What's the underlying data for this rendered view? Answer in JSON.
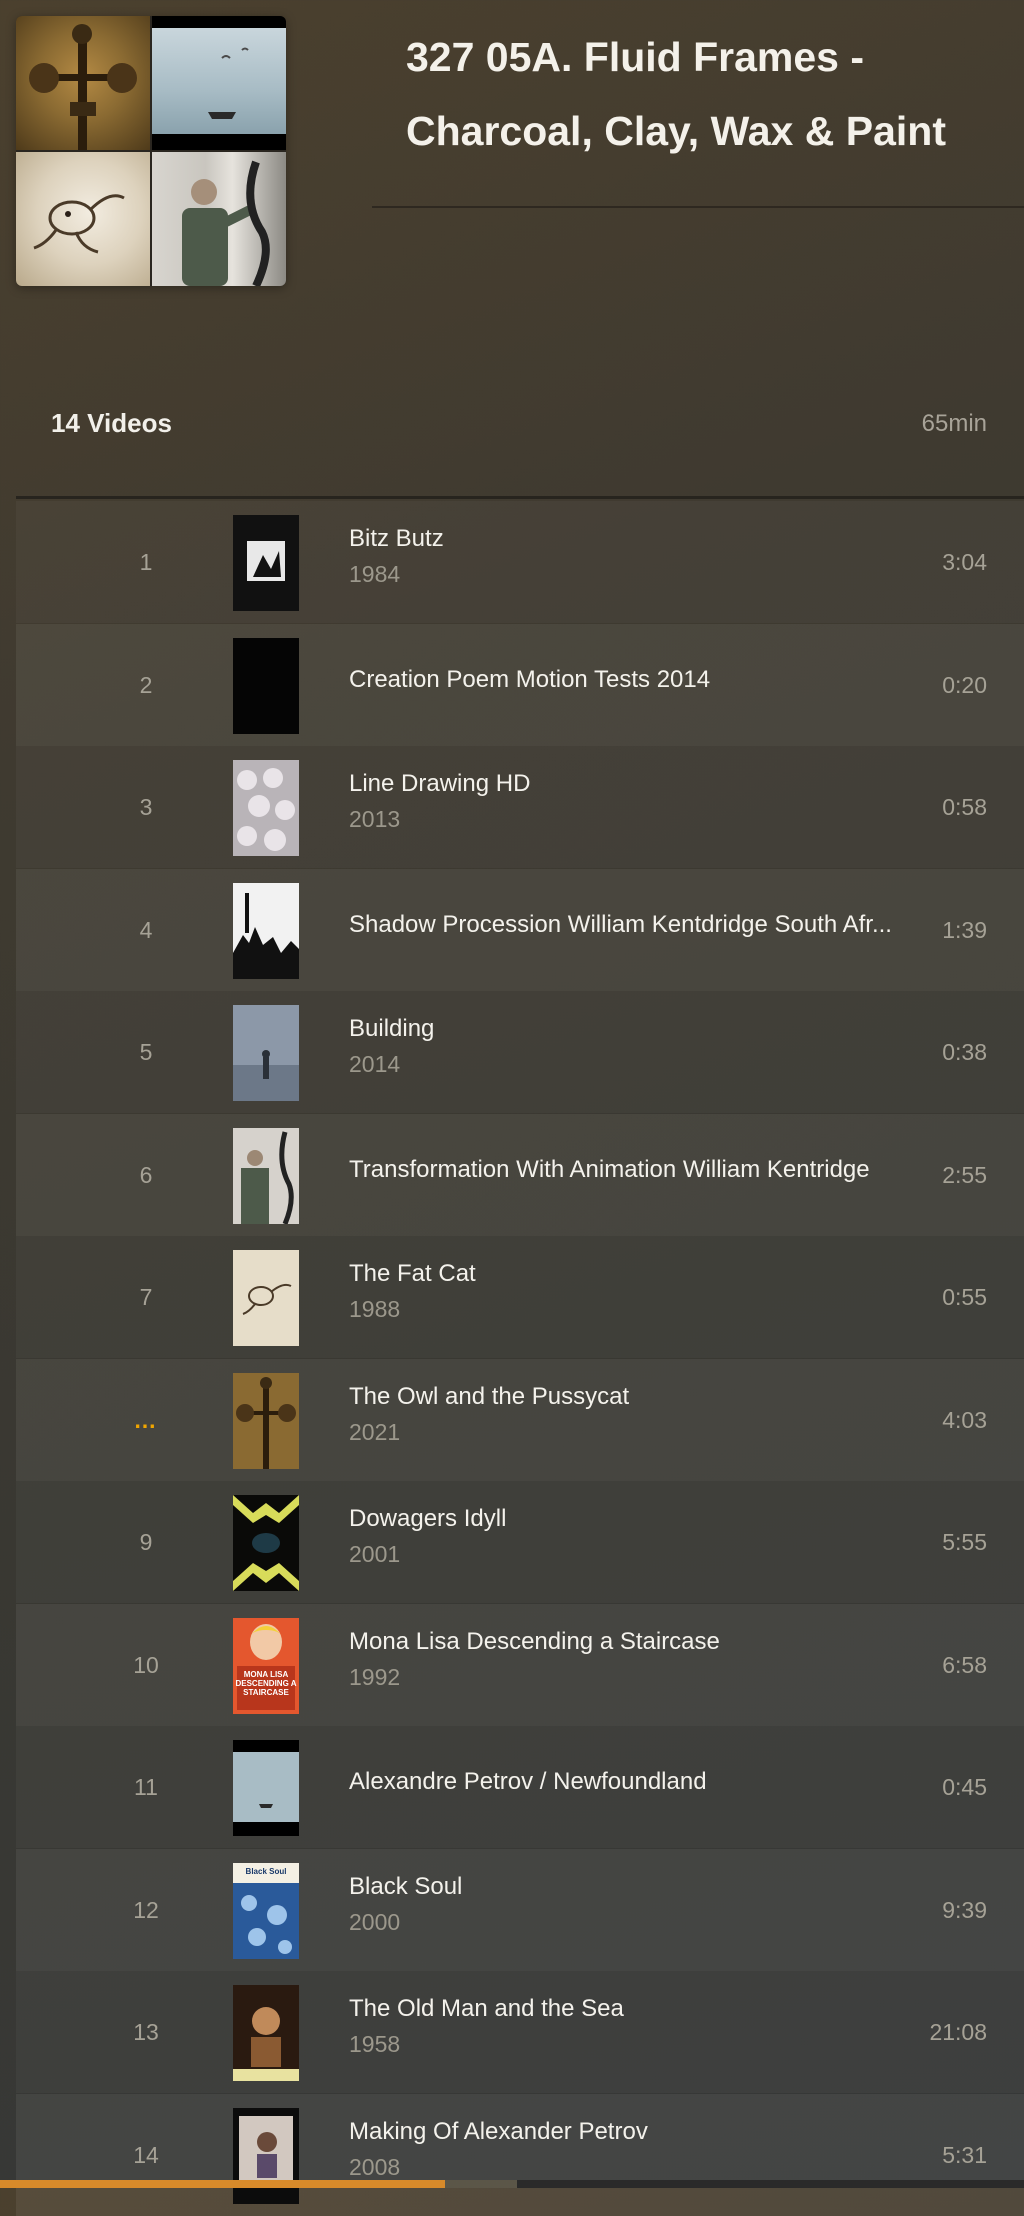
{
  "header": {
    "title": "327 05A. Fluid Frames - Charcoal, Clay, Wax & Paint"
  },
  "summary": {
    "count": "14 Videos",
    "total": "65min"
  },
  "videos": [
    {
      "number": "1",
      "title": "Bitz Butz",
      "year": "1984",
      "duration": "3:04",
      "thumb_icon": "bitz-butz-poster"
    },
    {
      "number": "2",
      "title": "Creation Poem Motion Tests 2014",
      "year": "",
      "duration": "0:20",
      "thumb_icon": "black-frame"
    },
    {
      "number": "3",
      "title": "Line Drawing HD",
      "year": "2013",
      "duration": "0:58",
      "thumb_icon": "pattern-frame"
    },
    {
      "number": "4",
      "title": "Shadow Procession William Kentdridge South Afr...",
      "year": "",
      "duration": "1:39",
      "thumb_icon": "silhouette-frame"
    },
    {
      "number": "5",
      "title": "Building",
      "year": "2014",
      "duration": "0:38",
      "thumb_icon": "foggy-figure-frame"
    },
    {
      "number": "6",
      "title": "Transformation With Animation William Kentridge",
      "year": "",
      "duration": "2:55",
      "thumb_icon": "artist-drawing-frame"
    },
    {
      "number": "7",
      "title": "The Fat Cat",
      "year": "1988",
      "duration": "0:55",
      "thumb_icon": "cat-sketch-frame"
    },
    {
      "number": "…",
      "title": "The Owl and the Pussycat",
      "year": "2021",
      "duration": "4:03",
      "thumb_icon": "owl-frame",
      "playing": true
    },
    {
      "number": "9",
      "title": "Dowagers Idyll",
      "year": "2001",
      "duration": "5:55",
      "thumb_icon": "kaleidoscope-frame"
    },
    {
      "number": "10",
      "title": "Mona Lisa Descending a Staircase",
      "year": "1992",
      "duration": "6:58",
      "thumb_icon": "mona-lisa-poster",
      "thumb_text": "MONA LISA DESCENDING A STAIRCASE"
    },
    {
      "number": "11",
      "title": "Alexandre Petrov / Newfoundland",
      "year": "",
      "duration": "0:45",
      "thumb_icon": "sea-frame"
    },
    {
      "number": "12",
      "title": "Black Soul",
      "year": "2000",
      "duration": "9:39",
      "thumb_icon": "black-soul-poster",
      "thumb_text": "Black Soul"
    },
    {
      "number": "13",
      "title": "The Old Man and the Sea",
      "year": "1958",
      "duration": "21:08",
      "thumb_icon": "old-man-frame"
    },
    {
      "number": "14",
      "title": "Making Of Alexander Petrov",
      "year": "2008",
      "duration": "5:31",
      "thumb_icon": "making-of-frame"
    }
  ],
  "playback": {
    "played_fraction": 0.435,
    "buffered_fraction": 0.505
  },
  "colors": {
    "accent": "#f0a500",
    "progress_played": "#d88a2a"
  }
}
